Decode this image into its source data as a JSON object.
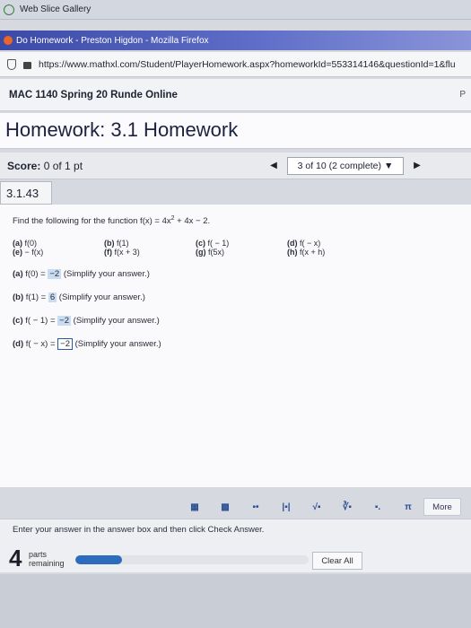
{
  "browser": {
    "bookmark": "Web Slice Gallery",
    "window_title": "Do Homework - Preston Higdon - Mozilla Firefox",
    "url": "https://www.mathxl.com/Student/PlayerHomework.aspx?homeworkId=553314146&questionId=1&flu"
  },
  "course": {
    "title": "MAC 1140 Spring 20 Runde Online",
    "right_edge": "P"
  },
  "homework": {
    "title": "Homework: 3.1 Homework",
    "score_label": "Score:",
    "score_value": "0 of 1 pt",
    "question_selector": "3 of 10 (2 complete)",
    "question_number": "3.1.43"
  },
  "problem": {
    "prompt_pre": "Find the following for the function f(x) = 4x",
    "prompt_exp": "2",
    "prompt_post": " + 4x − 2.",
    "options": [
      {
        "label": "(a)",
        "text": "f(0)"
      },
      {
        "label": "(b)",
        "text": "f(1)"
      },
      {
        "label": "(c)",
        "text": "f( − 1)"
      },
      {
        "label": "(d)",
        "text": "f( − x)"
      },
      {
        "label": "(e)",
        "text": " − f(x)"
      },
      {
        "label": "(f)",
        "text": "f(x + 3)"
      },
      {
        "label": "(g)",
        "text": "f(5x)"
      },
      {
        "label": "(h)",
        "text": "f(x + h)"
      }
    ],
    "answers": [
      {
        "label": "(a)",
        "expr": "f(0) =",
        "value": "−2",
        "hint": "(Simplify your answer.)"
      },
      {
        "label": "(b)",
        "expr": "f(1) =",
        "value": "6",
        "hint": "(Simplify your answer.)"
      },
      {
        "label": "(c)",
        "expr": "f( − 1) =",
        "value": "−2",
        "hint": "(Simplify your answer.)"
      },
      {
        "label": "(d)",
        "expr": "f( − x) =",
        "value": "−2",
        "hint": "(Simplify your answer.)"
      }
    ]
  },
  "toolbar": {
    "tools": [
      "fraction",
      "mixed-number",
      "exponent",
      "absolute-value",
      "sqrt",
      "nth-root",
      "subscript",
      "π"
    ],
    "more_label": "More"
  },
  "footer": {
    "instruction": "Enter your answer in the answer box and then click Check Answer.",
    "parts_count": "4",
    "parts_line1": "parts",
    "parts_line2": "remaining",
    "progress": 0.2,
    "clear_label": "Clear All"
  }
}
